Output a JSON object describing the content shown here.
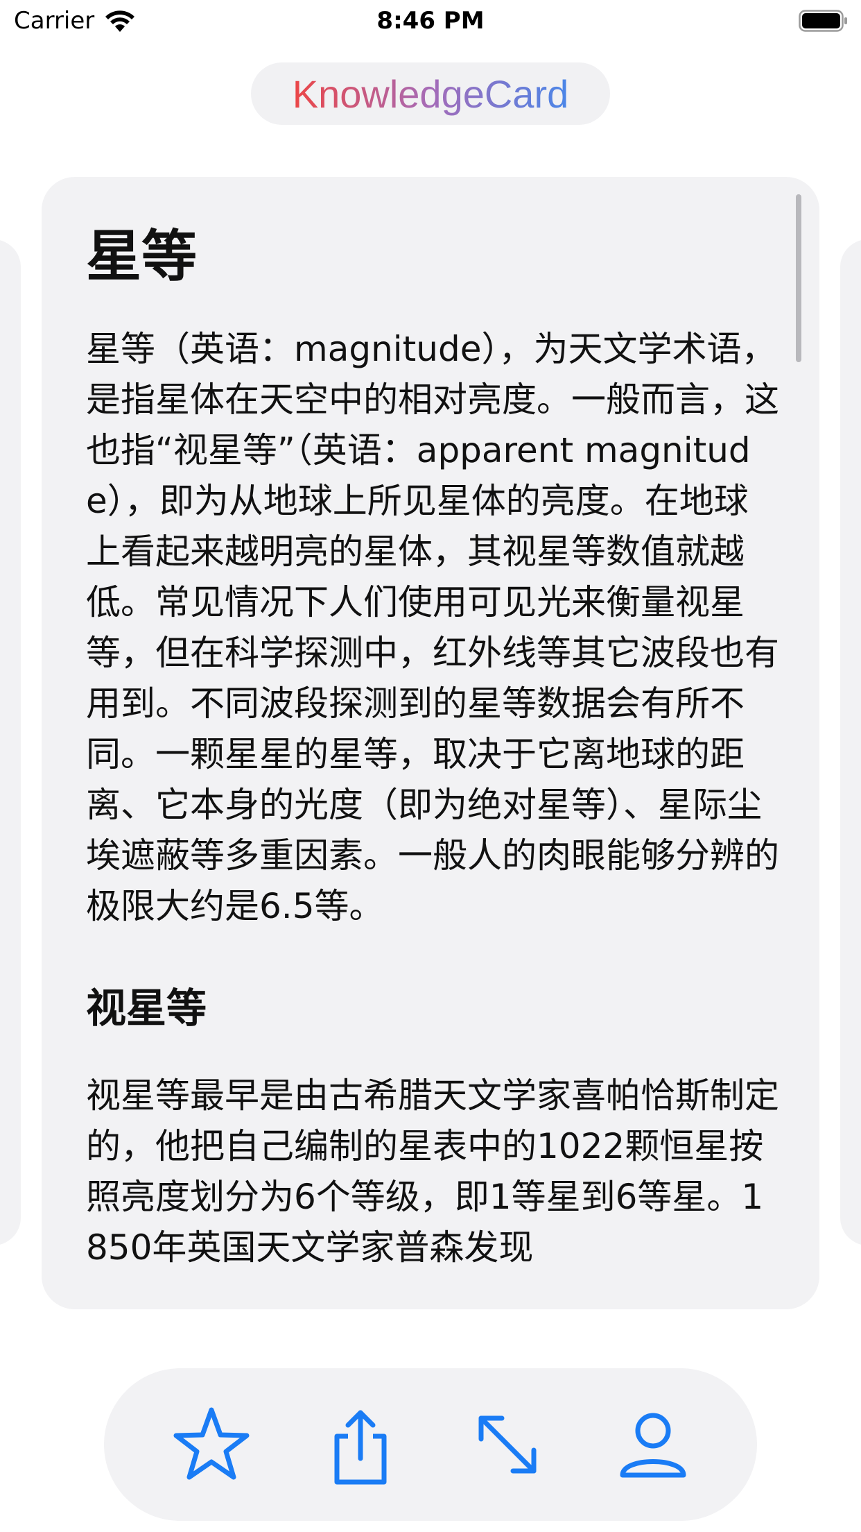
{
  "status_bar": {
    "carrier": "Carrier",
    "time": "8:46 PM",
    "wifi_icon": "wifi-icon",
    "battery_icon": "battery-icon"
  },
  "app": {
    "title": "KnowledgeCard",
    "title_gradient": [
      "#ec4646",
      "#a56bb8",
      "#4a86e8"
    ]
  },
  "card": {
    "title": "星等",
    "paragraph": "星等（英语：magnitude），为天文学术语，是指星体在天空中的相对亮度。一般而言，这也指“视星等”（英语：apparent magnitude），即为从地球上所见星体的亮度。在地球上看起来越明亮的星体，其视星等数值就越低。常见情况下人们使用可见光来衡量视星等，但在科学探测中，红外线等其它波段也有用到。不同波段探测到的星等数据会有所不同。一颗星星的星等，取决于它离地球的距离、它本身的光度（即为绝对星等）、星际尘埃遮蔽等多重因素。一般人的肉眼能够分辨的极限大约是6.5等。",
    "subtitle": "视星等",
    "paragraph2": "视星等最早是由古希腊天文学家喜帕恰斯制定的，他把自己编制的星表中的1022颗恒星按照亮度划分为6个等级，即1等星到6等星。1850年英国天文学家普森发现"
  },
  "toolbar": {
    "accent_color": "#1a7cf5",
    "buttons": [
      {
        "icon": "star-icon"
      },
      {
        "icon": "share-icon"
      },
      {
        "icon": "expand-icon"
      },
      {
        "icon": "person-icon"
      }
    ]
  }
}
